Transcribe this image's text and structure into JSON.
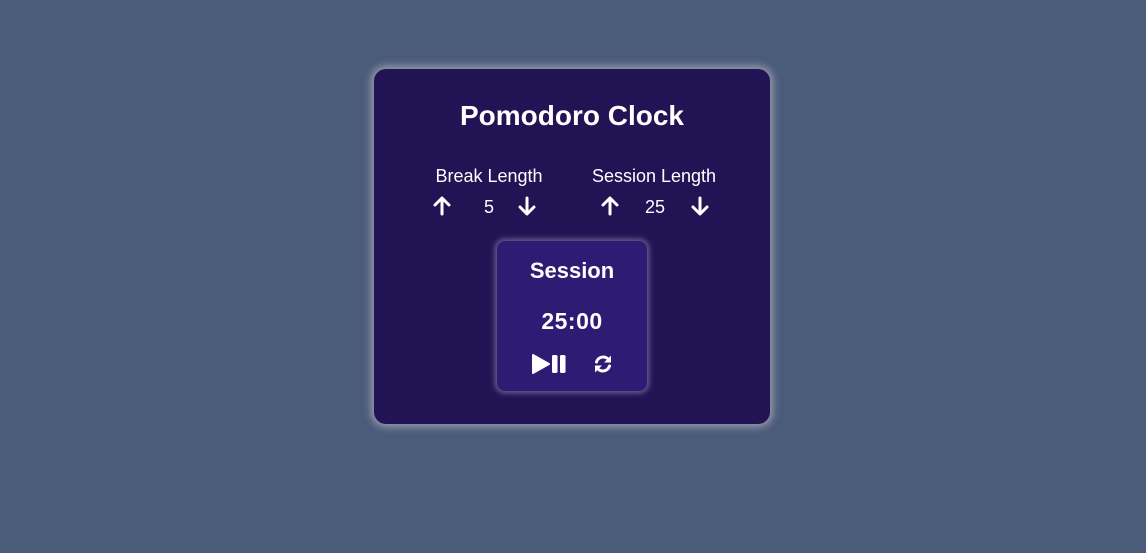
{
  "app": {
    "title": "Pomodoro Clock"
  },
  "break": {
    "label": "Break Length",
    "value": "5"
  },
  "session": {
    "label": "Session Length",
    "value": "25"
  },
  "timer": {
    "label": "Session",
    "time": "25:00"
  },
  "icons": {
    "increment": "arrow-up-icon",
    "decrement": "arrow-down-icon",
    "play_pause": "play-pause-icon",
    "reset": "refresh-icon"
  },
  "colors": {
    "page_background": "#4b5b7a",
    "card_background": "#221355",
    "timer_background": "#2e1b73",
    "text": "#ffffff"
  }
}
